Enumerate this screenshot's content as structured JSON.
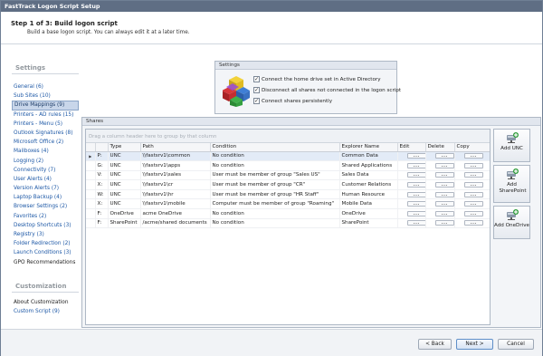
{
  "window": {
    "title": "FastTrack Logon Script Setup"
  },
  "header": {
    "step": "Step 1 of 3: Build logon script",
    "subtitle": "Build a base logon script. You can always edit it at a later time."
  },
  "sidebar": {
    "settings_title": "Settings",
    "items": [
      {
        "label": "General (6)"
      },
      {
        "label": "Sub Sites (10)"
      },
      {
        "label": "Drive Mappings (9)",
        "active": true
      },
      {
        "label": "Printers - AD rules (15)"
      },
      {
        "label": "Printers - Menu (5)"
      },
      {
        "label": "Outlook Signatures (8)"
      },
      {
        "label": "Microsoft Office (2)"
      },
      {
        "label": "Mailboxes (4)"
      },
      {
        "label": "Logging (2)"
      },
      {
        "label": "Connectivity (7)"
      },
      {
        "label": "User Alerts (4)"
      },
      {
        "label": "Version Alerts (7)"
      },
      {
        "label": "Laptop Backup (4)"
      },
      {
        "label": "Browser Settings (2)"
      },
      {
        "label": "Favorites (2)"
      },
      {
        "label": "Desktop Shortcuts (3)"
      },
      {
        "label": "Registry (3)"
      },
      {
        "label": "Folder Redirection (2)"
      },
      {
        "label": "Launch Conditions (3)"
      },
      {
        "label": "GPO Recommendations"
      }
    ],
    "customization_title": "Customization",
    "custom_items": [
      {
        "label": "About Customization"
      },
      {
        "label": "Custom Script (9)"
      }
    ]
  },
  "settings_box": {
    "title": "Settings",
    "options": [
      {
        "label": "Connect the home drive set in Active Directory",
        "checked": true
      },
      {
        "label": "Disconnect all shares not connected in the logon script",
        "checked": true
      },
      {
        "label": "Connect shares persistently",
        "checked": true
      }
    ]
  },
  "shares": {
    "title": "Shares",
    "group_hint": "Drag a column header here to group by that column",
    "columns": [
      "",
      "Type",
      "Path",
      "Condition",
      "Explorer Name",
      "Edit",
      "Delete",
      "Copy"
    ],
    "rows": [
      {
        "drive": "P:",
        "type": "UNC",
        "path": "\\\\fastsrv1\\common",
        "condition": "No condition",
        "name": "Common Data",
        "selected": true
      },
      {
        "drive": "G:",
        "type": "UNC",
        "path": "\\\\fastsrv1\\apps",
        "condition": "No condition",
        "name": "Shared Applications"
      },
      {
        "drive": "V:",
        "type": "UNC",
        "path": "\\\\fastsrv1\\sales",
        "condition": "User must be member of group \"Sales US\"",
        "name": "Sales Data"
      },
      {
        "drive": "X:",
        "type": "UNC",
        "path": "\\\\fastsrv1\\cr",
        "condition": "User must be member of group \"CR\"",
        "name": "Customer Relations"
      },
      {
        "drive": "W:",
        "type": "UNC",
        "path": "\\\\fastsrv1\\hr",
        "condition": "User must be member of group \"HR Staff\"",
        "name": "Human Resource"
      },
      {
        "drive": "X:",
        "type": "UNC",
        "path": "\\\\fastsrv1\\mobile",
        "condition": "Computer must be member of group \"Roaming\"",
        "name": "Mobile Data"
      },
      {
        "drive": "F:",
        "type": "OneDrive",
        "path": "acme OneDrive",
        "condition": "No condition",
        "name": "OneDrive"
      },
      {
        "drive": "F:",
        "type": "SharePoint",
        "path": "/acme/shared documents",
        "condition": "No condition",
        "name": "SharePoint"
      }
    ],
    "edit_label": "...",
    "buttons": {
      "add_unc": "Add UNC",
      "add_sharepoint": "Add SharePoint",
      "add_onedrive": "Add OneDrive"
    }
  },
  "footer": {
    "back": "< Back",
    "next": "Next >",
    "cancel": "Cancel"
  },
  "colors": {
    "titlebar": "#5f6e84",
    "link": "#1d58a6",
    "selection": "#e3ebf7"
  }
}
